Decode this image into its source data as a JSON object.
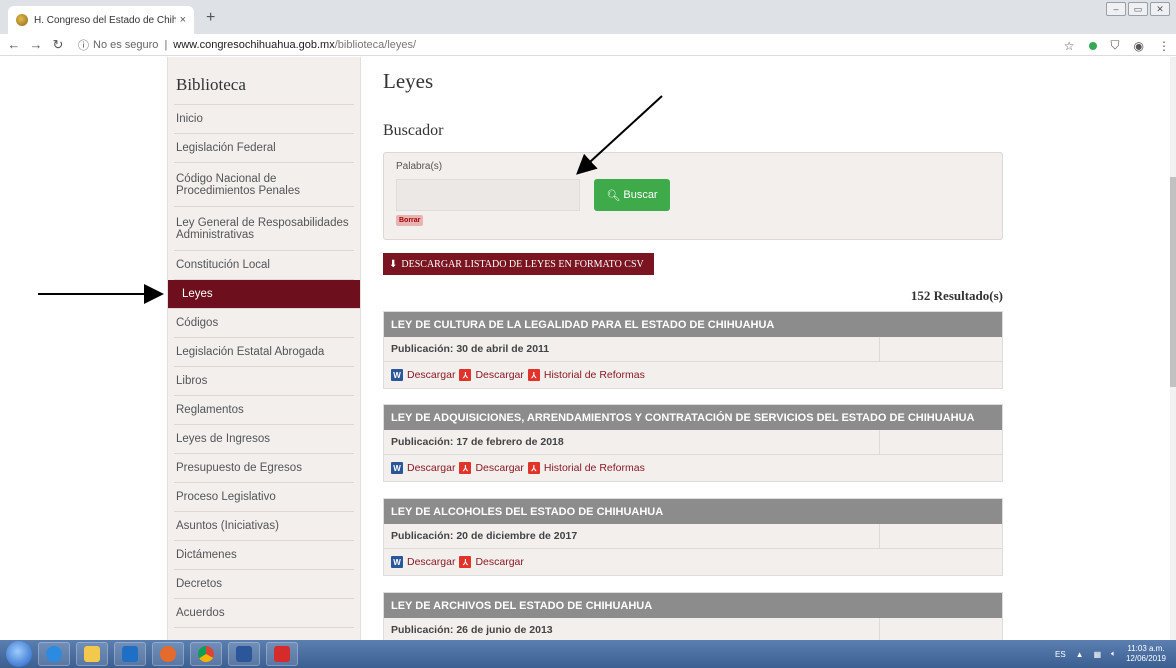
{
  "browser": {
    "tab_title": "H. Congreso del Estado de Chihu",
    "tab_close": "×",
    "new_tab": "+",
    "security": "No es seguro",
    "url_host": "www.congresochihuahua.gob.mx",
    "url_path": "/biblioteca/leyes/"
  },
  "sidebar": {
    "title": "Biblioteca",
    "items": [
      {
        "label": "Inicio",
        "h": 29
      },
      {
        "label": "Legislación Federal",
        "h": 29
      },
      {
        "label": "Código Nacional de Procedimientos Penales",
        "h": 44
      },
      {
        "label": "Ley General de Resposabilidades Administrativas",
        "h": 44
      },
      {
        "label": "Constitución Local",
        "h": 29
      },
      {
        "label": "Leyes",
        "h": 29
      },
      {
        "label": "Códigos",
        "h": 29
      },
      {
        "label": "Legislación Estatal Abrogada",
        "h": 29
      },
      {
        "label": "Libros",
        "h": 29
      },
      {
        "label": "Reglamentos",
        "h": 29
      },
      {
        "label": "Leyes de Ingresos",
        "h": 29
      },
      {
        "label": "Presupuesto de Egresos",
        "h": 29
      },
      {
        "label": "Proceso Legislativo",
        "h": 29
      },
      {
        "label": "Asuntos (Iniciativas)",
        "h": 29
      },
      {
        "label": "Dictámenes",
        "h": 29
      },
      {
        "label": "Decretos",
        "h": 29
      },
      {
        "label": "Acuerdos",
        "h": 29
      }
    ],
    "active": "Leyes"
  },
  "main": {
    "heading": "Leyes",
    "search_heading": "Buscador",
    "search_label": "Palabra(s)",
    "search_value": "",
    "search_button": "Buscar",
    "clear_button": "Borrar",
    "csv_button": "DESCARGAR LISTADO DE LEYES EN FORMATO CSV",
    "results": "152 Resultado(s)"
  },
  "laws": [
    {
      "title": "LEY DE CULTURA DE LA LEGALIDAD PARA EL ESTADO DE CHIHUAHUA",
      "pub": "Publicación: 30 de abril de 2011",
      "links": [
        "Descargar",
        "Descargar",
        "Historial de Reformas"
      ]
    },
    {
      "title": "LEY DE ADQUISICIONES, ARRENDAMIENTOS Y CONTRATACIÓN DE SERVICIOS DEL ESTADO DE CHIHUAHUA",
      "pub": "Publicación: 17 de febrero de 2018",
      "links": [
        "Descargar",
        "Descargar",
        "Historial de Reformas"
      ]
    },
    {
      "title": "LEY DE ALCOHOLES DEL ESTADO DE CHIHUAHUA",
      "pub": "Publicación: 20 de diciembre de 2017",
      "links": [
        "Descargar",
        "Descargar"
      ]
    },
    {
      "title": "LEY DE ARCHIVOS DEL ESTADO DE CHIHUAHUA",
      "pub": "Publicación: 26 de junio de 2013",
      "links": []
    }
  ],
  "taskbar": {
    "lang": "ES",
    "time": "11:03 a.m.",
    "date": "12/06/2019"
  },
  "colors": {
    "accent": "#6d0f1c",
    "search_button": "#3eaa4a",
    "card_header": "#8c8c8c",
    "link": "#8b1a24"
  }
}
